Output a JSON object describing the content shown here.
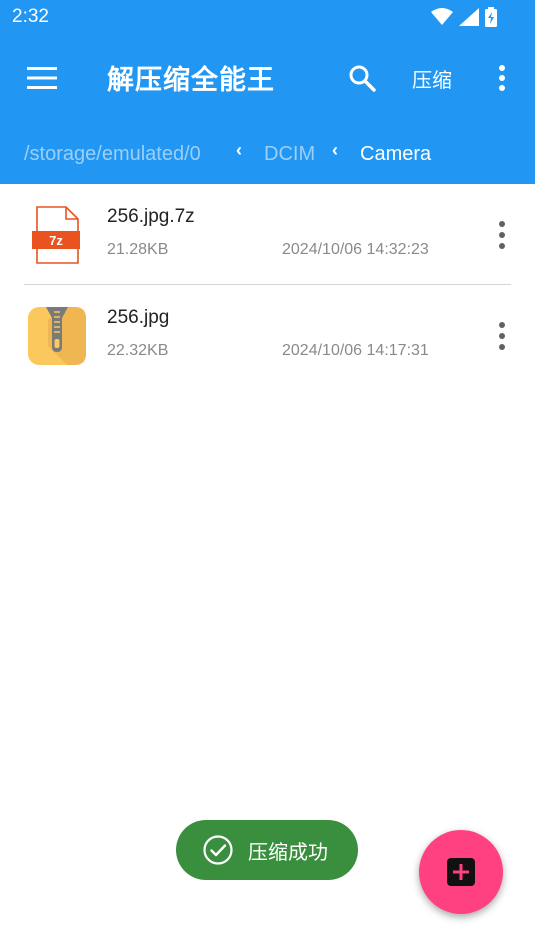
{
  "status_bar": {
    "time": "2:32"
  },
  "toolbar": {
    "title": "解压缩全能王",
    "compress_label": "压缩"
  },
  "breadcrumb": {
    "items": [
      "/storage/emulated/0",
      "DCIM",
      "Camera"
    ]
  },
  "files": [
    {
      "name": "256.jpg.7z",
      "size": "21.28KB",
      "date": "2024/10/06 14:32:23",
      "icon_label": "7z"
    },
    {
      "name": "256.jpg",
      "size": "22.32KB",
      "date": "2024/10/06 14:17:31"
    }
  ],
  "toast": {
    "message": "压缩成功"
  },
  "colors": {
    "primary": "#2196F3",
    "fab": "#FF4081",
    "toast": "#3a8f3f",
    "archive_orange": "#E8531F"
  }
}
